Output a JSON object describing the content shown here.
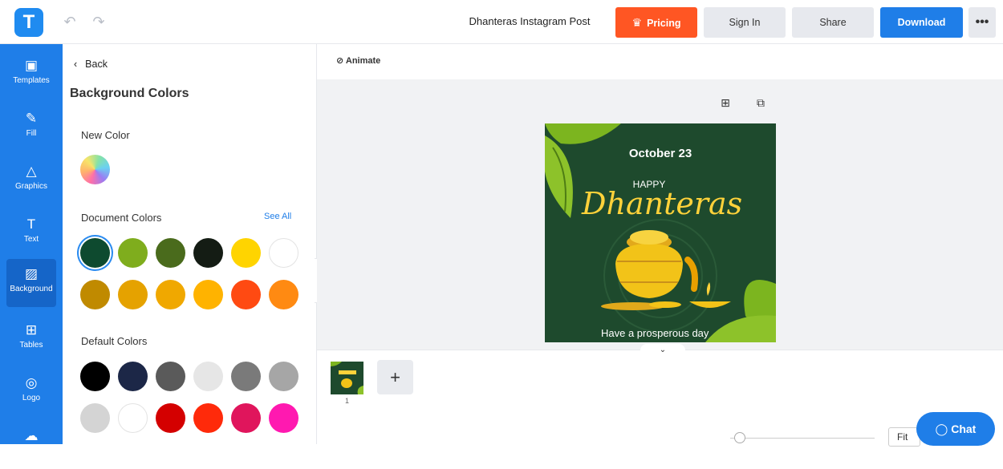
{
  "header": {
    "logo_letter": "T",
    "title": "Dhanteras Instagram Post",
    "pricing_label": "Pricing",
    "signin_label": "Sign In",
    "share_label": "Share",
    "download_label": "Download",
    "more_label": "•••"
  },
  "rail": {
    "items": [
      {
        "label": "Templates",
        "icon": "templates-icon"
      },
      {
        "label": "Fill",
        "icon": "pencil-icon"
      },
      {
        "label": "Graphics",
        "icon": "shapes-icon"
      },
      {
        "label": "Text",
        "icon": "text-icon"
      },
      {
        "label": "Background",
        "icon": "background-icon"
      },
      {
        "label": "Tables",
        "icon": "table-icon"
      },
      {
        "label": "Logo",
        "icon": "logo-icon"
      },
      {
        "label": "",
        "icon": "cloud-upload-icon"
      }
    ],
    "active": "Background"
  },
  "panel": {
    "back_label": "Back",
    "title": "Background Colors",
    "new_color_label": "New Color",
    "document_colors_label": "Document Colors",
    "see_all_label": "See All",
    "default_colors_label": "Default Colors",
    "document_colors": [
      "#0e4a2f",
      "#7fad1d",
      "#4a6b1c",
      "#141c14",
      "#ffd400",
      "#ffffff",
      "#c08a00",
      "#e5a200",
      "#f0a800",
      "#ffb300",
      "#ff4a12",
      "#ff8a12"
    ],
    "default_colors": [
      "#000000",
      "#1c2747",
      "#5a5a5a",
      "#e6e6e6",
      "#7a7a7a",
      "#a6a6a6",
      "#d4d4d4",
      "#ffffff",
      "#d40000",
      "#ff2a0a",
      "#e0155c",
      "#ff19b0"
    ]
  },
  "canvas": {
    "animate_label": "Animate",
    "design": {
      "date": "October 23",
      "happy": "HAPPY",
      "title": "Dhanteras",
      "tagline": "Have a prosperous day"
    },
    "page_number": "1",
    "zoom_label": "Fit"
  },
  "chat": {
    "label": "Chat"
  }
}
